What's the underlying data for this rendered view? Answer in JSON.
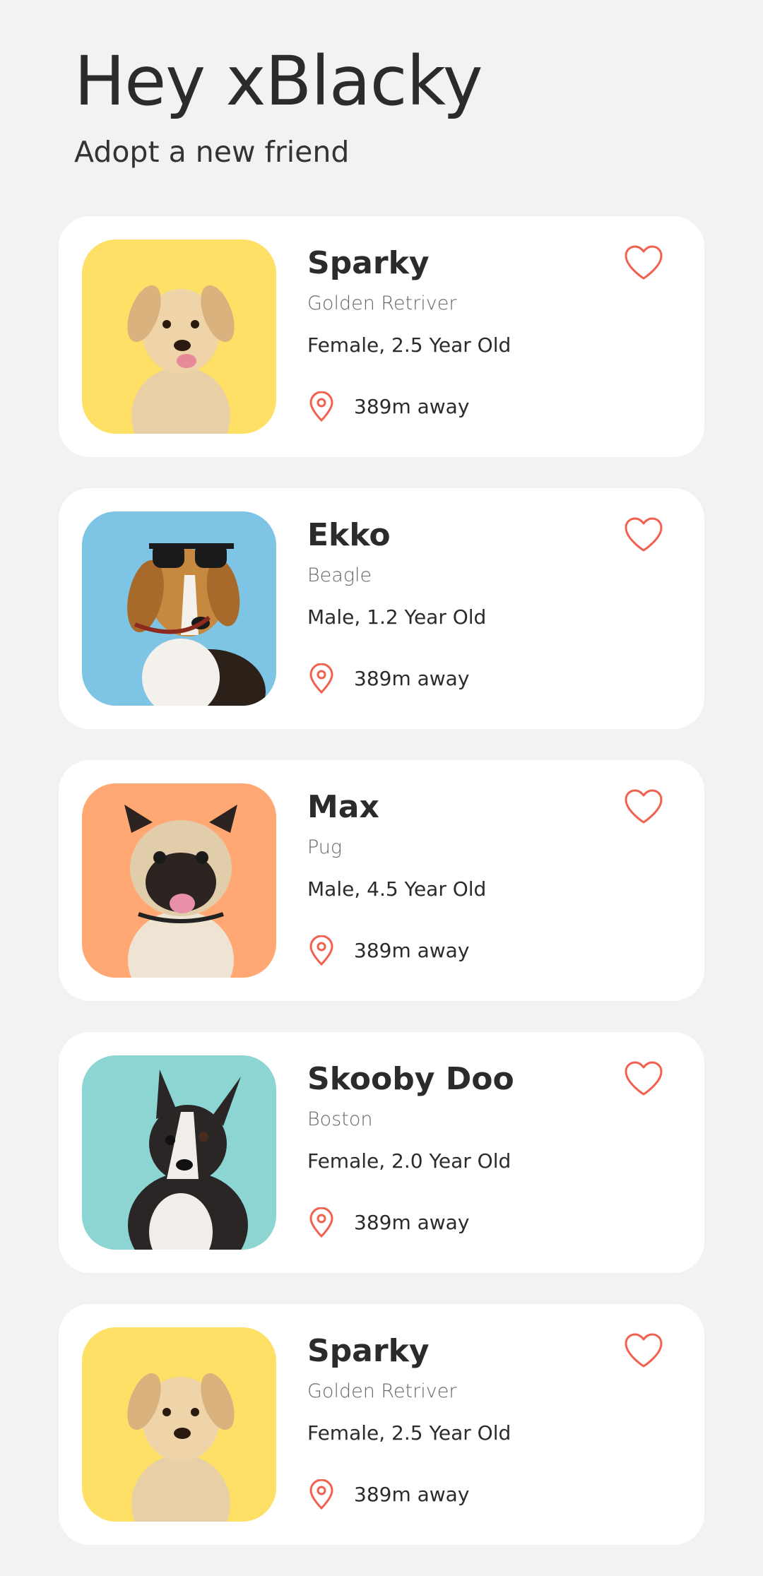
{
  "header": {
    "greeting": "Hey xBlacky",
    "subtitle": "Adopt a new friend"
  },
  "colors": {
    "accent": "#f2604f",
    "background": "#f2f2f2",
    "card": "#ffffff"
  },
  "pets": [
    {
      "name": "Sparky",
      "breed": "Golden Retriver",
      "info": "Female, 2.5 Year Old",
      "distance": "389m away",
      "photo_bg": "#ffe066",
      "dog": "labrador-puppy"
    },
    {
      "name": "Ekko",
      "breed": "Beagle",
      "info": "Male, 1.2 Year Old",
      "distance": "389m away",
      "photo_bg": "#7ec4e4",
      "dog": "beagle-sunglasses"
    },
    {
      "name": "Max",
      "breed": "Pug",
      "info": "Male, 4.5 Year Old",
      "distance": "389m away",
      "photo_bg": "#ffa874",
      "dog": "pug"
    },
    {
      "name": "Skooby Doo",
      "breed": "Boston",
      "info": "Female, 2.0 Year Old",
      "distance": "389m away",
      "photo_bg": "#8dd5d2",
      "dog": "french-bulldog"
    },
    {
      "name": "Sparky",
      "breed": "Golden Retriver",
      "info": "Female, 2.5 Year Old",
      "distance": "389m away",
      "photo_bg": "#ffe066",
      "dog": "labrador-puppy"
    }
  ]
}
